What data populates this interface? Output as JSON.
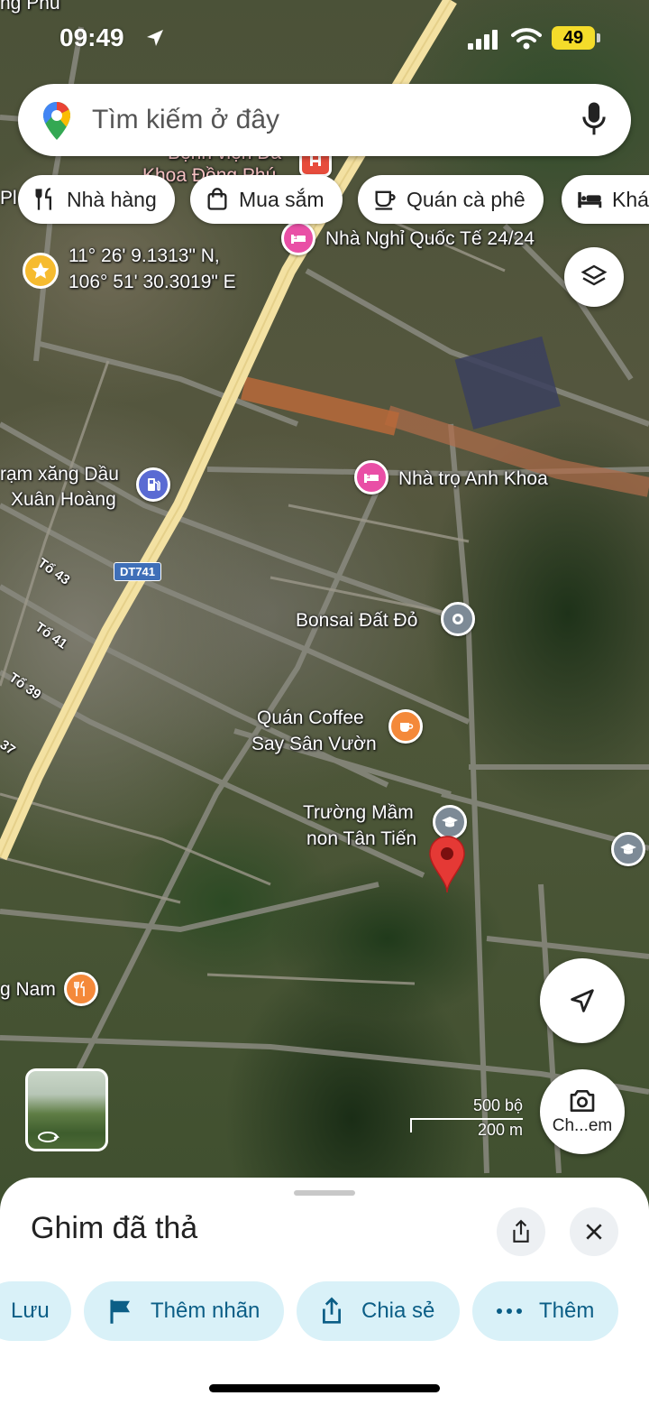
{
  "status_bar": {
    "time": "09:49",
    "battery": "49"
  },
  "search": {
    "placeholder": "Tìm kiếm ở đây"
  },
  "chips": [
    {
      "label": "Nhà hàng",
      "icon": "fork-knife-icon"
    },
    {
      "label": "Mua sắm",
      "icon": "shopping-bag-icon"
    },
    {
      "label": "Quán cà phê",
      "icon": "coffee-cup-icon"
    },
    {
      "label": "Khá",
      "icon": "bed-icon"
    }
  ],
  "coordinates": {
    "lat": "11° 26' 9.1313\" N,",
    "lng": "106° 51' 30.3019\" E"
  },
  "map_labels": {
    "top_partial": "ng Phú",
    "hospital_line1": "Bệnh viện Đa",
    "hospital_line2": "Khoa Đồng Phú",
    "left_edge": "Pl",
    "hotel_intl": "Nhà Nghỉ Quốc Tế 24/24",
    "gas_station_line1": "rạm xăng Dầu",
    "gas_station_line2": "Xuân Hoàng",
    "guesthouse": "Nhà trọ Anh Khoa",
    "road_shield": "DT741",
    "to43": "Tổ 43",
    "to41": "Tổ 41",
    "to39": "Tổ 39",
    "to37": "37",
    "bonsai": "Bonsai Đất Đỏ",
    "coffee_line1": "Quán Coffee",
    "coffee_line2": "Say Sân Vườn",
    "school_line1": "Trường Mầm",
    "school_line2": "non Tân Tiến",
    "restaurant_partial": "g Nam"
  },
  "map_controls": {
    "lens_label": "Ch...em"
  },
  "scale": {
    "top": "500 bộ",
    "bottom": "200 m"
  },
  "sheet": {
    "title": "Ghim đã thả",
    "actions": [
      {
        "label": "Lưu",
        "icon": "bookmark-icon"
      },
      {
        "label": "Thêm nhãn",
        "icon": "flag-icon"
      },
      {
        "label": "Chia sẻ",
        "icon": "share-icon"
      },
      {
        "label": "Thêm",
        "icon": "more-dots-icon"
      }
    ]
  },
  "colors": {
    "pin_red": "#e53935",
    "lodging_pink": "#e94fa6",
    "food_orange": "#f4893a",
    "fuel_blue": "#5a6bd3",
    "education_gray": "#7d8a96",
    "action_bg": "#d9f1f8",
    "action_text": "#0b5e86"
  }
}
